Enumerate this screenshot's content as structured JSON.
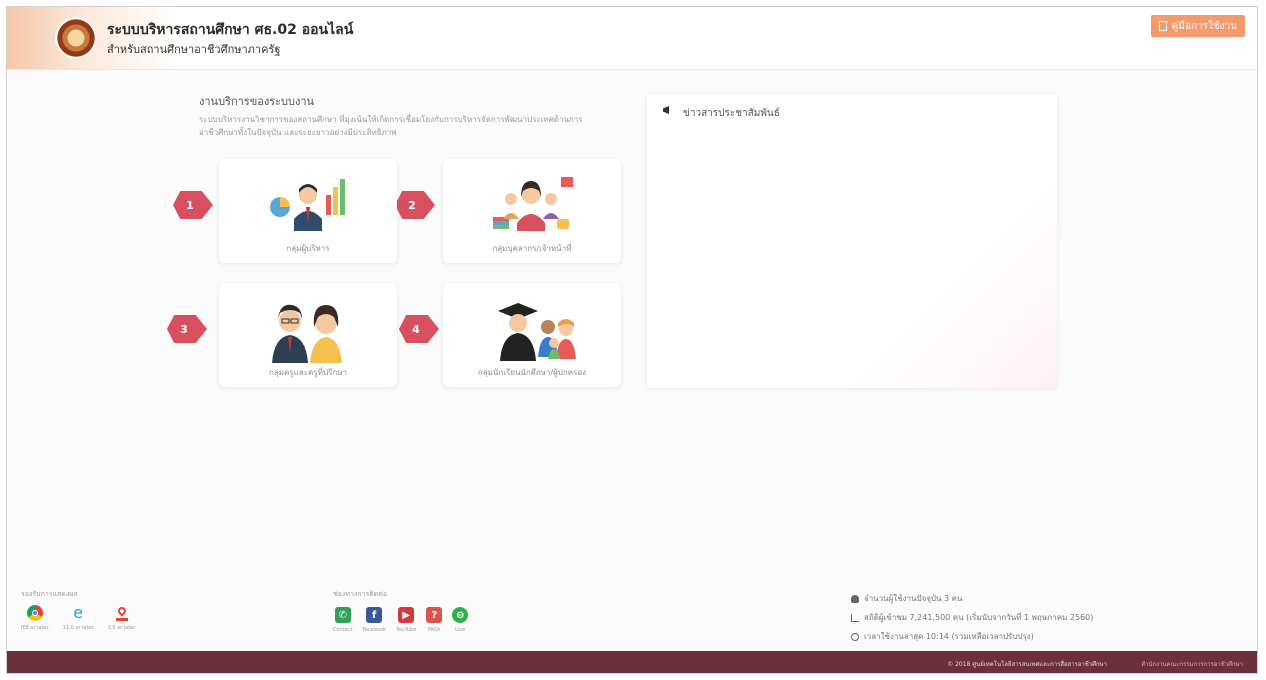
{
  "header": {
    "title": "ระบบบริหารสถานศึกษา ศธ.02 ออนไลน์",
    "subtitle": "สำหรับสถานศึกษาอาชีวศึกษาภาครัฐ",
    "manual_label": "คู่มือการใช้งาน",
    "accent_color": "#f39b6d"
  },
  "intro": {
    "title": "งานบริการของระบบงาน",
    "description": "ระบบบริหารงานวิชาการของสถานศึกษา ที่มุ่งเน้นให้เกิดการเชื่อมโยงกับการบริหารจัดการพัฒนาประเทศด้านการอาชีวศึกษาทั้งในปัจจุบัน และระยะยาวอย่างมีประสิทธิภาพ"
  },
  "groups": [
    {
      "number": "1",
      "label": "กลุ่มผู้บริหาร",
      "icon": "executive-icon"
    },
    {
      "number": "2",
      "label": "กลุ่มบุคลากร/เจ้าหน้าที่",
      "icon": "staff-icon"
    },
    {
      "number": "3",
      "label": "กลุ่มครูและครูที่ปรึกษา",
      "icon": "teacher-icon"
    },
    {
      "number": "4",
      "label": "กลุ่มนักเรียนนักศึกษา/ผู้ปกครอง",
      "icon": "student-parent-icon"
    }
  ],
  "news": {
    "title": "ข่าวสารประชาสัมพันธ์",
    "icon": "megaphone-icon"
  },
  "footer": {
    "browser_title": "รองรับการแสดงผล",
    "browsers": [
      {
        "caption": "IE8 or later",
        "icon": "chrome-icon"
      },
      {
        "caption": "11.0 or later",
        "icon": "ie-icon"
      },
      {
        "caption": "3.0 or later",
        "icon": "pdf-icon"
      }
    ],
    "contact_title": "ช่องทางการติดต่อ",
    "contacts": [
      {
        "caption": "Contact",
        "icon": "phone-icon",
        "color": "#2f9e57"
      },
      {
        "caption": "Facebook",
        "icon": "facebook-icon",
        "color": "#3b5998"
      },
      {
        "caption": "YouTube",
        "icon": "youtube-icon",
        "color": "#d23b3b"
      },
      {
        "caption": "FAQs",
        "icon": "question-icon",
        "color": "#d9534f"
      },
      {
        "caption": "Line",
        "icon": "line-icon",
        "color": "#2db14b"
      }
    ],
    "stats": [
      {
        "icon": "user-icon",
        "text": "จำนวนผู้ใช้งานปัจจุบัน   3 คน"
      },
      {
        "icon": "chart-icon",
        "text": "สถิติผู้เข้าชม   7,241,500 คน (เริ่มนับจากวันที่ 1 พฤษภาคม 2560)"
      },
      {
        "icon": "clock-icon",
        "text": "เวลาใช้งานล่าสุด   10:14 (รวมเหลือเวลาปรับปรุง)"
      }
    ],
    "copyright": "© 2018 ศูนย์เทคโนโลยีสารสนเทศและการสื่อสารอาชีวศึกษา",
    "copyright_link": "สำนักงานคณะกรรมการการอาชีวศึกษา",
    "bar_color": "#6b2f3d"
  }
}
